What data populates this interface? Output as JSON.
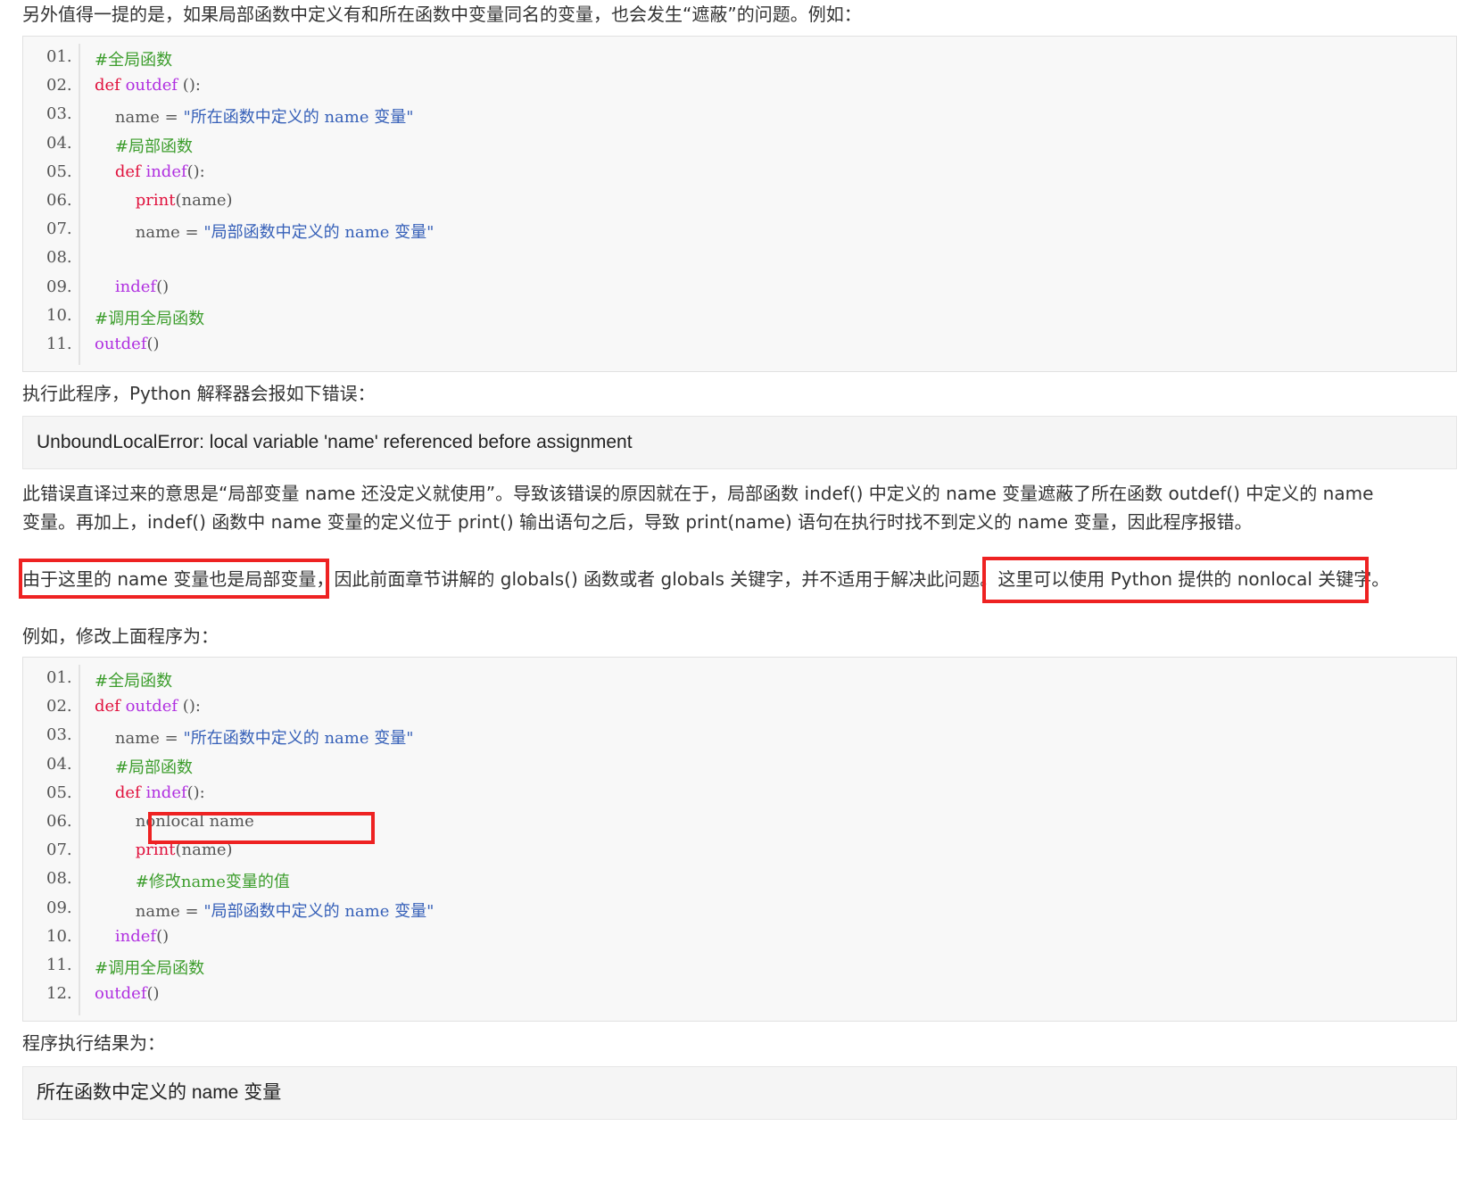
{
  "intro": "另外值得一提的是，如果局部函数中定义有和所在函数中变量同名的变量，也会发生“遮蔽”的问题。例如：",
  "code1": [
    {
      "n": "01.",
      "parts": [
        {
          "t": "#全局函数",
          "c": "cm"
        }
      ]
    },
    {
      "n": "02.",
      "parts": [
        {
          "t": "def ",
          "c": "kw"
        },
        {
          "t": "outdef ",
          "c": "fn"
        },
        {
          "t": "():",
          "c": "pl"
        }
      ]
    },
    {
      "n": "03.",
      "parts": [
        {
          "t": "    name = ",
          "c": "pl"
        },
        {
          "t": "\"所在函数中定义的 name 变量\"",
          "c": "str"
        }
      ]
    },
    {
      "n": "04.",
      "parts": [
        {
          "t": "    #局部函数",
          "c": "cm"
        }
      ]
    },
    {
      "n": "05.",
      "parts": [
        {
          "t": "    def ",
          "c": "kw"
        },
        {
          "t": "indef",
          "c": "fn"
        },
        {
          "t": "():",
          "c": "pl"
        }
      ]
    },
    {
      "n": "06.",
      "parts": [
        {
          "t": "        print",
          "c": "kw"
        },
        {
          "t": "(name)",
          "c": "pl"
        }
      ]
    },
    {
      "n": "07.",
      "parts": [
        {
          "t": "        name = ",
          "c": "pl"
        },
        {
          "t": "\"局部函数中定义的 name 变量\"",
          "c": "str"
        }
      ]
    },
    {
      "n": "08.",
      "parts": []
    },
    {
      "n": "09.",
      "parts": [
        {
          "t": "    indef",
          "c": "fn"
        },
        {
          "t": "()",
          "c": "pl"
        }
      ]
    },
    {
      "n": "10.",
      "parts": [
        {
          "t": "#调用全局函数",
          "c": "cm"
        }
      ]
    },
    {
      "n": "11.",
      "parts": [
        {
          "t": "outdef",
          "c": "fn"
        },
        {
          "t": "()",
          "c": "pl"
        }
      ]
    }
  ],
  "run_text": "执行此程序，Python 解释器会报如下错误：",
  "error_text": "UnboundLocalError: local variable 'name' referenced before assignment",
  "explain_line1": "此错误直译过来的意思是“局部变量 name 还没定义就使用”。导致该错误的原因就在于，局部函数 indef() 中定义的 name 变量遮蔽了所在函数 outdef() 中定义的 name",
  "explain_line2": "变量。再加上，indef() 函数中 name 变量的定义位于 print() 输出语句之后，导致 print(name) 语句在执行时找不到定义的 name 变量，因此程序报错。",
  "note_a": "由于这里的 name 变量也是局部变量，",
  "note_b": "因此前面章节讲解的 globals() 函数或者 globals 关键字，并不适用于解决此问题。",
  "note_c": "这里可以使用 Python 提供的 nonlocal 关键字。",
  "modify_text": "例如，修改上面程序为：",
  "code2": [
    {
      "n": "01.",
      "parts": [
        {
          "t": "#全局函数",
          "c": "cm"
        }
      ]
    },
    {
      "n": "02.",
      "parts": [
        {
          "t": "def ",
          "c": "kw"
        },
        {
          "t": "outdef ",
          "c": "fn"
        },
        {
          "t": "():",
          "c": "pl"
        }
      ]
    },
    {
      "n": "03.",
      "parts": [
        {
          "t": "    name = ",
          "c": "pl"
        },
        {
          "t": "\"所在函数中定义的 name 变量\"",
          "c": "str"
        }
      ]
    },
    {
      "n": "04.",
      "parts": [
        {
          "t": "    #局部函数",
          "c": "cm"
        }
      ]
    },
    {
      "n": "05.",
      "parts": [
        {
          "t": "    def ",
          "c": "kw"
        },
        {
          "t": "indef",
          "c": "fn"
        },
        {
          "t": "():",
          "c": "pl"
        }
      ]
    },
    {
      "n": "06.",
      "parts": [
        {
          "t": "        nonlocal name",
          "c": "pl"
        }
      ]
    },
    {
      "n": "07.",
      "parts": [
        {
          "t": "        print",
          "c": "kw"
        },
        {
          "t": "(name)",
          "c": "pl"
        }
      ]
    },
    {
      "n": "08.",
      "parts": [
        {
          "t": "        #修改name变量的值",
          "c": "cm"
        }
      ]
    },
    {
      "n": "09.",
      "parts": [
        {
          "t": "        name = ",
          "c": "pl"
        },
        {
          "t": "\"局部函数中定义的 name 变量\"",
          "c": "str"
        }
      ]
    },
    {
      "n": "10.",
      "parts": [
        {
          "t": "    indef",
          "c": "fn"
        },
        {
          "t": "()",
          "c": "pl"
        }
      ]
    },
    {
      "n": "11.",
      "parts": [
        {
          "t": "#调用全局函数",
          "c": "cm"
        }
      ]
    },
    {
      "n": "12.",
      "parts": [
        {
          "t": "outdef",
          "c": "fn"
        },
        {
          "t": "()",
          "c": "pl"
        }
      ]
    }
  ],
  "result_label": "程序执行结果为：",
  "result_text": "所在函数中定义的 name 变量",
  "colors": {
    "accent_red": "#ee2222",
    "keyword": "#e0113d",
    "function": "#b030e0",
    "comment": "#3c9d2c",
    "string": "#3660b8"
  }
}
